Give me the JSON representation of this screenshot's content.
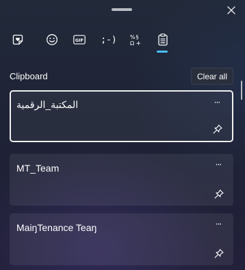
{
  "header": {
    "close_label": "×"
  },
  "tabs": [
    {
      "name": "kaomoji-stickers",
      "label": "",
      "icon": "heart-sticker-icon",
      "active": false
    },
    {
      "name": "emoji",
      "label": "",
      "icon": "smiley-icon",
      "active": false
    },
    {
      "name": "gif",
      "label": "GIF",
      "icon": "gif-icon",
      "active": false
    },
    {
      "name": "kaomoji",
      "label": ";-)",
      "icon": "kaomoji-icon",
      "active": false
    },
    {
      "name": "symbols",
      "label": "",
      "icon": "symbols-icon",
      "active": false
    },
    {
      "name": "clipboard",
      "label": "",
      "icon": "clipboard-icon",
      "active": true
    }
  ],
  "clipboard": {
    "title": "Clipboard",
    "clear_all_label": "Clear all",
    "items": [
      {
        "text": "المكتبة_الرقمية",
        "selected": true,
        "direction": "rtl"
      },
      {
        "text": "MT_Team",
        "selected": false,
        "direction": "ltr"
      },
      {
        "text": "MaiŋTenance Teaŋ",
        "selected": false,
        "direction": "ltr"
      }
    ],
    "more_label": "···"
  },
  "colors": {
    "accent": "#4cc2ff",
    "background": "#20263a",
    "card": "#2c3244"
  }
}
